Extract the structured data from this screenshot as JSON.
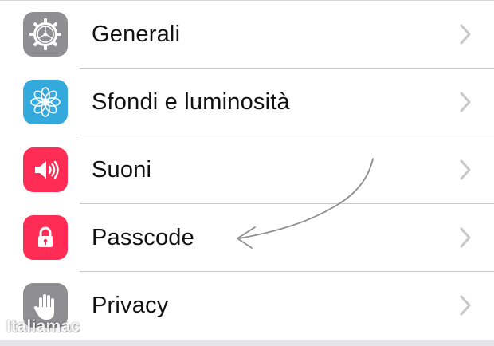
{
  "settings": {
    "items": [
      {
        "label": "Generali",
        "icon": "gear-icon",
        "color": "#8e8e93"
      },
      {
        "label": "Sfondi e luminosità",
        "icon": "flower-icon",
        "color": "#34aadc"
      },
      {
        "label": "Suoni",
        "icon": "speaker-icon",
        "color": "#ff2d55"
      },
      {
        "label": "Passcode",
        "icon": "lock-icon",
        "color": "#ff2d55"
      },
      {
        "label": "Privacy",
        "icon": "hand-icon",
        "color": "#8e8e93"
      }
    ]
  },
  "watermark": {
    "text": "Italiamac"
  }
}
